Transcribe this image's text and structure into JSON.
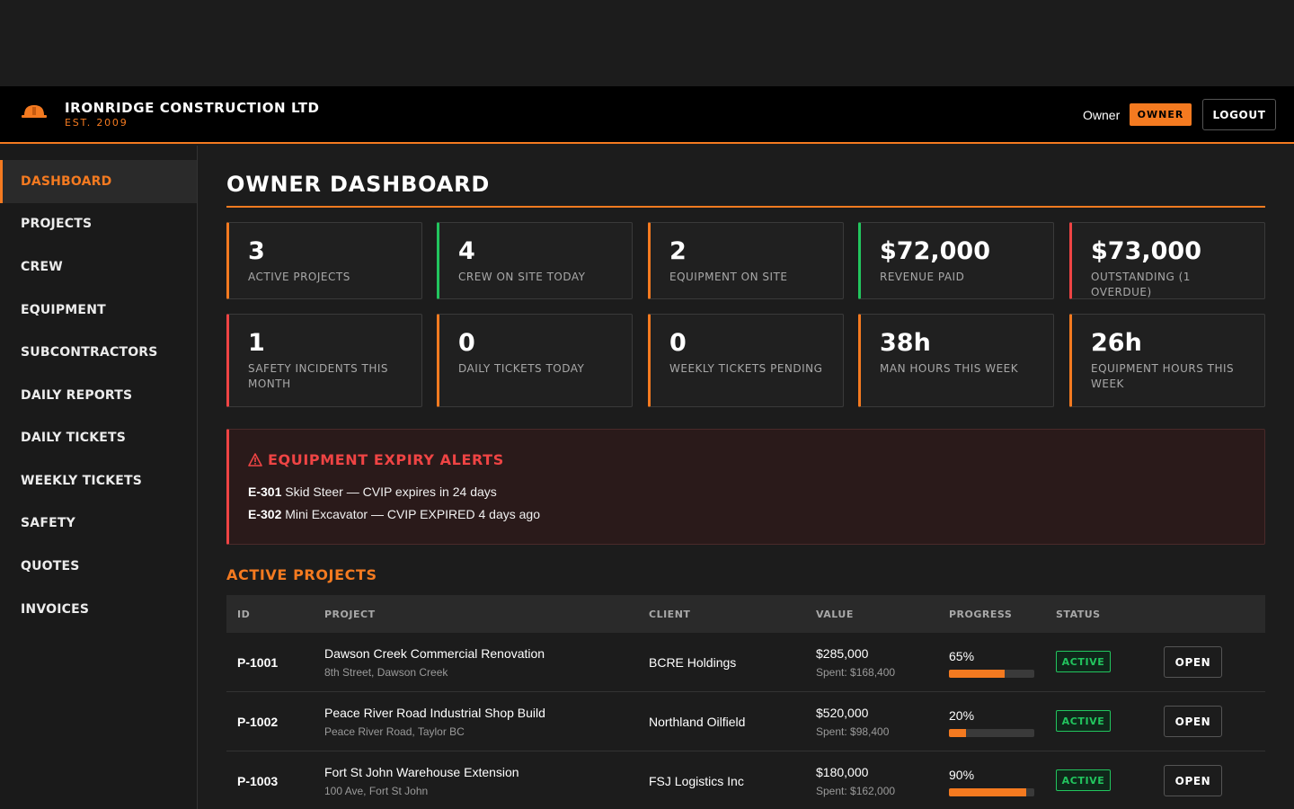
{
  "header": {
    "company_name": "IRONRIDGE CONSTRUCTION LTD",
    "established": "EST. 2009",
    "user_role": "Owner",
    "role_badge": "OWNER",
    "logout_label": "LOGOUT"
  },
  "sidebar": {
    "items": [
      {
        "label": "DASHBOARD",
        "active": true
      },
      {
        "label": "PROJECTS"
      },
      {
        "label": "CREW"
      },
      {
        "label": "EQUIPMENT"
      },
      {
        "label": "SUBCONTRACTORS"
      },
      {
        "label": "DAILY REPORTS"
      },
      {
        "label": "DAILY TICKETS"
      },
      {
        "label": "WEEKLY TICKETS"
      },
      {
        "label": "SAFETY"
      },
      {
        "label": "QUOTES"
      },
      {
        "label": "INVOICES"
      }
    ]
  },
  "main": {
    "title": "OWNER DASHBOARD",
    "stats": [
      {
        "value": "3",
        "label": "ACTIVE PROJECTS",
        "accent": "orange"
      },
      {
        "value": "4",
        "label": "CREW ON SITE TODAY",
        "accent": "green"
      },
      {
        "value": "2",
        "label": "EQUIPMENT ON SITE",
        "accent": "orange"
      },
      {
        "value": "$72,000",
        "label": "REVENUE PAID",
        "accent": "green"
      },
      {
        "value": "$73,000",
        "label": "OUTSTANDING (1 OVERDUE)",
        "accent": "red"
      },
      {
        "value": "1",
        "label": "SAFETY INCIDENTS THIS MONTH",
        "accent": "red"
      },
      {
        "value": "0",
        "label": "DAILY TICKETS TODAY",
        "accent": "orange"
      },
      {
        "value": "0",
        "label": "WEEKLY TICKETS PENDING",
        "accent": "orange"
      },
      {
        "value": "38h",
        "label": "MAN HOURS THIS WEEK",
        "accent": "orange"
      },
      {
        "value": "26h",
        "label": "EQUIPMENT HOURS THIS WEEK",
        "accent": "orange"
      }
    ],
    "alerts": {
      "icon": "warning-icon",
      "title": "EQUIPMENT EXPIRY ALERTS",
      "items": [
        {
          "id": "E-301",
          "text": "Skid Steer — CVIP expires in 24 days"
        },
        {
          "id": "E-302",
          "text": "Mini Excavator — CVIP EXPIRED 4 days ago"
        }
      ]
    },
    "projects": {
      "title": "ACTIVE PROJECTS",
      "columns": [
        "ID",
        "PROJECT",
        "CLIENT",
        "VALUE",
        "PROGRESS",
        "STATUS"
      ],
      "rows": [
        {
          "id": "P-1001",
          "name": "Dawson Creek Commercial Renovation",
          "location": "8th Street, Dawson Creek",
          "client": "BCRE Holdings",
          "value": "$285,000",
          "spent": "Spent: $168,400",
          "progress_label": "65%",
          "progress": 0.65,
          "status": "ACTIVE",
          "action": "OPEN"
        },
        {
          "id": "P-1002",
          "name": "Peace River Road Industrial Shop Build",
          "location": "Peace River Road, Taylor BC",
          "client": "Northland Oilfield",
          "value": "$520,000",
          "spent": "Spent: $98,400",
          "progress_label": "20%",
          "progress": 0.2,
          "status": "ACTIVE",
          "action": "OPEN"
        },
        {
          "id": "P-1003",
          "name": "Fort St John Warehouse Extension",
          "location": "100 Ave, Fort St John",
          "client": "FSJ Logistics Inc",
          "value": "$180,000",
          "spent": "Spent: $162,000",
          "progress_label": "90%",
          "progress": 0.9,
          "status": "ACTIVE",
          "action": "OPEN"
        }
      ]
    }
  },
  "colors": {
    "accent": "#f47a20",
    "success": "#22c55e",
    "danger": "#ef4444",
    "background": "#1c1c1c"
  }
}
